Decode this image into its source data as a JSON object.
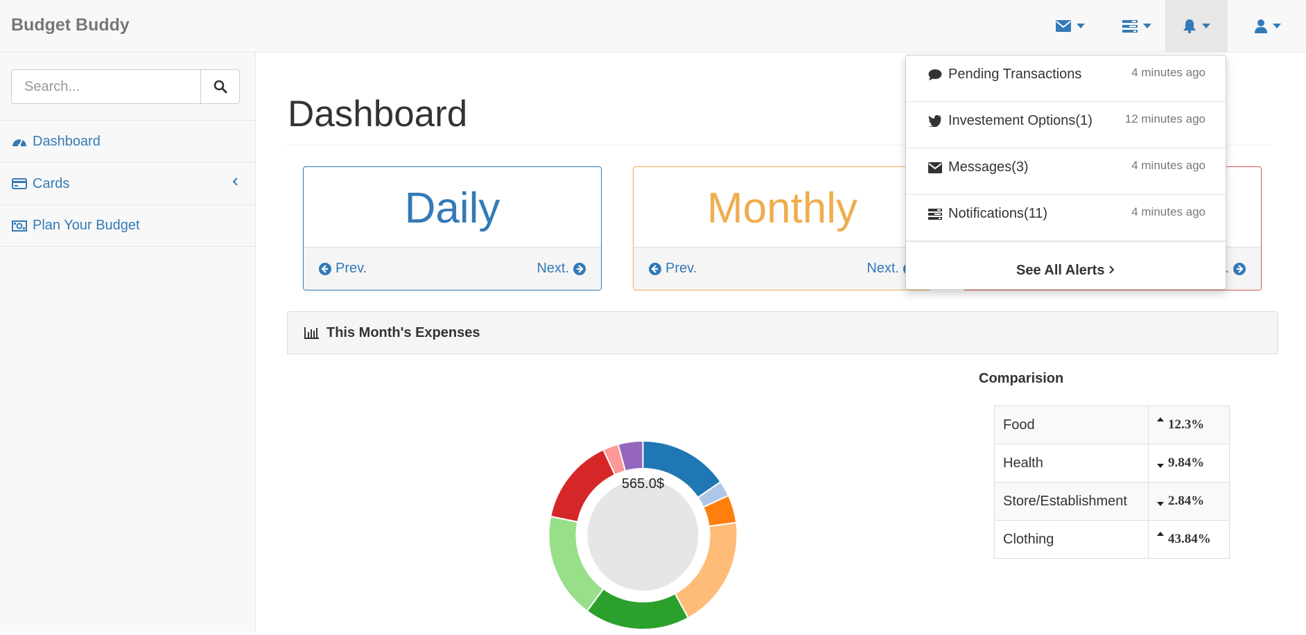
{
  "navbar": {
    "brand": "Budget Buddy",
    "icons": [
      "envelope-icon",
      "tasks-icon",
      "bell-icon",
      "user-icon"
    ]
  },
  "sidebar": {
    "search_placeholder": "Search...",
    "items": [
      {
        "label": "Dashboard",
        "icon": "dashboard-icon"
      },
      {
        "label": "Cards",
        "icon": "credit-card-icon"
      },
      {
        "label": "Plan Your Budget",
        "icon": "money-icon"
      }
    ]
  },
  "main": {
    "title": "Dashboard",
    "cards": [
      {
        "label": "Daily",
        "prev": "Prev.",
        "next": "Next.",
        "color": "#337ab7"
      },
      {
        "label": "Monthly",
        "prev": "Prev.",
        "next": "Next.",
        "color": "#f0ad4e"
      },
      {
        "label": "",
        "prev": "",
        "next": ".",
        "color": "#d9534f"
      }
    ],
    "expenses_title": "This Month's Expenses",
    "donut_center": "565.0$",
    "comparison": {
      "title": "Comparision",
      "rows": [
        {
          "name": "Food",
          "direction": "up",
          "value": "12.3%"
        },
        {
          "name": "Health",
          "direction": "down",
          "value": "9.84%"
        },
        {
          "name": "Store/Establishment",
          "direction": "down",
          "value": "2.84%"
        },
        {
          "name": "Clothing",
          "direction": "up",
          "value": "43.84%"
        }
      ]
    }
  },
  "alerts": {
    "items": [
      {
        "label": "Pending Transactions",
        "time": "4 minutes ago",
        "icon": "comment-icon"
      },
      {
        "label": "Investement Options(1)",
        "time": "12 minutes ago",
        "icon": "twitter-icon"
      },
      {
        "label": "Messages(3)",
        "time": "4 minutes ago",
        "icon": "envelope-icon"
      },
      {
        "label": "Notifications(11)",
        "time": "4 minutes ago",
        "icon": "tasks-icon"
      }
    ],
    "see_all": "See All Alerts"
  },
  "colors": {
    "accent": "#337ab7",
    "monthly": "#f0ad4e",
    "danger": "#d9534f"
  },
  "chart_data": {
    "type": "pie",
    "categories": [
      "",
      "",
      "",
      "",
      "",
      "",
      "",
      "",
      ""
    ],
    "values": [
      14.5,
      2.5,
      4.5,
      18,
      17,
      17,
      14,
      2.5,
      4
    ],
    "colors": [
      "#1f77b4",
      "#aec7e8",
      "#ff7f0e",
      "#ffbb78",
      "#2ca02c",
      "#98df8a",
      "#d62728",
      "#ff9896",
      "#9467bd"
    ],
    "title": "",
    "center_label": "565.0$"
  }
}
